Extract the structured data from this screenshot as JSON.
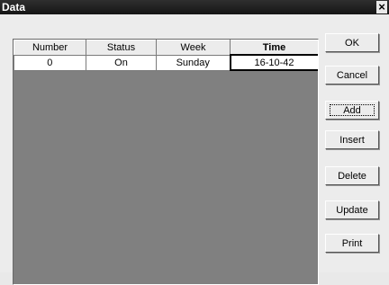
{
  "window": {
    "title": "Data",
    "close_glyph": "×"
  },
  "grid": {
    "columns": [
      "Number",
      "Status",
      "Week",
      "Time"
    ],
    "rows": [
      [
        "0",
        "On",
        "Sunday",
        "16-10-42"
      ]
    ]
  },
  "buttons": {
    "ok": "OK",
    "cancel": "Cancel",
    "add": "Add",
    "insert": "Insert",
    "delete": "Delete",
    "update": "Update",
    "print": "Print"
  }
}
